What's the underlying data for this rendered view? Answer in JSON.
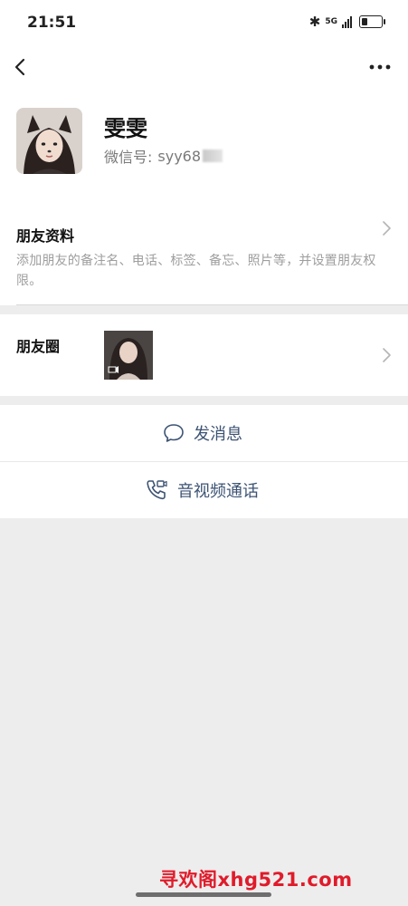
{
  "status_bar": {
    "time": "21:51",
    "network": "5G",
    "bluetooth": "bluetooth-icon",
    "battery_level": 0.3
  },
  "nav": {
    "back_icon": "chevron-left-icon",
    "more_icon": "more-horizontal-icon"
  },
  "profile": {
    "name": "雯雯",
    "wechat_id_label": "微信号:",
    "wechat_id_value": "syy68"
  },
  "friend_info": {
    "title": "朋友资料",
    "description": "添加朋友的备注名、电话、标签、备忘、照片等，并设置朋友权限。"
  },
  "moments": {
    "title": "朋友圈"
  },
  "actions": {
    "message_label": "发消息",
    "call_label": "音视频通话"
  },
  "watermark": "寻欢阁xhg521.com",
  "colors": {
    "link": "#3d5373",
    "background": "#ededed",
    "watermark": "#e01b2a"
  }
}
